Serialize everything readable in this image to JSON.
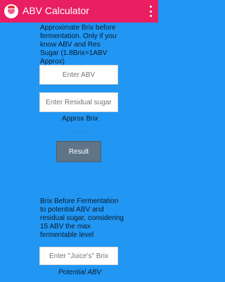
{
  "app": {
    "title": "ABV Calculator"
  },
  "section1": {
    "text": "Approximate Brix before fermentation. Only if you know ABV and Res Sugar (1.8Brix=1ABV Approx)",
    "abv_placeholder": "Enter ABV",
    "sugar_placeholder": "Enter Residual sugar",
    "result_label": "Approx Brix",
    "result_value": "........",
    "button_label": "Result"
  },
  "section2": {
    "text": "Brix Before Fermentation to potential ABV and residual sugar, considering 15 ABV the max fermentable level",
    "brix_placeholder": "Enter \"Juice's\" Brix",
    "result_label": "Potential ABV"
  }
}
